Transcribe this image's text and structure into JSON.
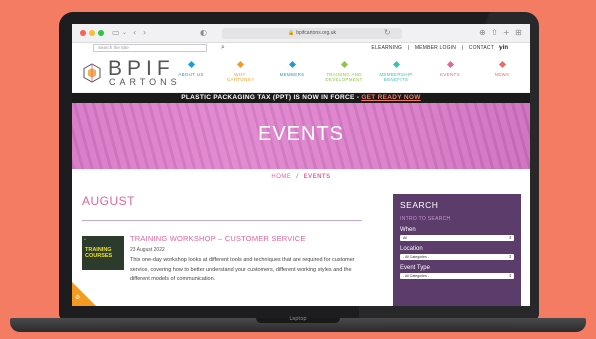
{
  "browser": {
    "url": "bpifcartons.org.uk",
    "icons": [
      "sidebar-icon",
      "back-icon",
      "forward-icon",
      "shield-icon",
      "reload-icon",
      "download-icon",
      "share-icon",
      "new-tab-icon",
      "grid-icon"
    ]
  },
  "topbar": {
    "search_placeholder": "Search the Site",
    "links": [
      "ELEARNING",
      "|",
      "MEMBER LOGIN",
      "|",
      "CONTACT"
    ],
    "social": "twitter linkedin"
  },
  "logo": {
    "title": "BPIF",
    "subtitle": "CARTONS"
  },
  "nav": [
    {
      "label": "ABOUT US",
      "color": "#1e9bd7"
    },
    {
      "label": "WHY CARTONS?",
      "color": "#f39a1f"
    },
    {
      "label": "MEMBERS",
      "color": "#1e9bd7"
    },
    {
      "label": "TRAINING AND DEVELOPMENT",
      "color": "#8dc63f"
    },
    {
      "label": "MEMBERSHIP BENEFITS",
      "color": "#3fbfad"
    },
    {
      "label": "EVENTS",
      "color": "#e3649c"
    },
    {
      "label": "NEWS",
      "color": "#ee6a5f"
    }
  ],
  "banner": {
    "text": "PLASTIC PACKAGING TAX (PPT) IS NOW IN FORCE - ",
    "link": "GET READY NOW"
  },
  "hero": {
    "title": "EVENTS"
  },
  "breadcrumb": {
    "home": "HOME",
    "separator": "/",
    "current": "EVENTS"
  },
  "content": {
    "month": "AUGUST",
    "events": [
      {
        "thumb_text": "TRAINING COURSES",
        "title": "TRAINING WORKSHOP – CUSTOMER SERVICE",
        "date": "23 August 2022",
        "description": "This one-day workshop looks at different tools and techniques that are required for customer service, covering how to better understand your customers, different working styles and the different models of communication."
      }
    ]
  },
  "sidebar": {
    "title": "SEARCH",
    "intro": "INTRO TO SEARCH",
    "fields": [
      {
        "label": "When",
        "value": "All"
      },
      {
        "label": "Location",
        "value": "- All Categories -"
      },
      {
        "label": "Event Type",
        "value": "- All Categories -"
      }
    ]
  },
  "device": {
    "label": "Laptop"
  },
  "colors": {
    "accent_pink": "#e3649c",
    "sidebar_purple": "#5b3c6a",
    "background": "#f47c62"
  }
}
